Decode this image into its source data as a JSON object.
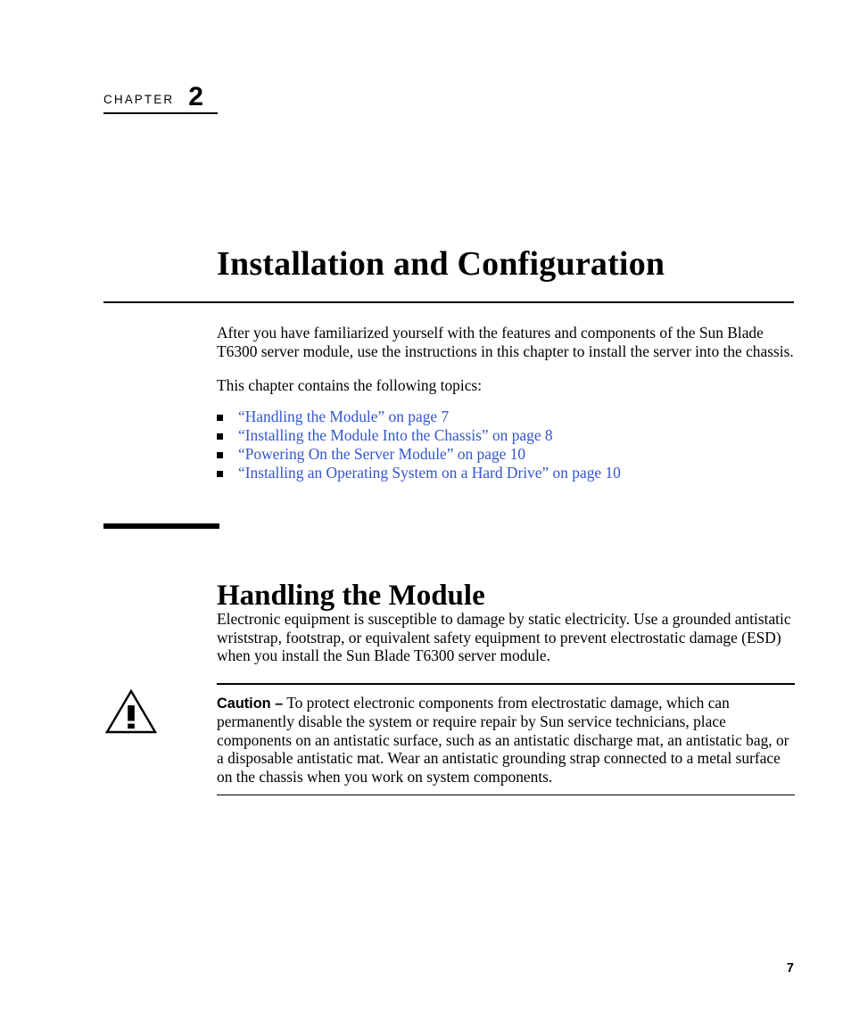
{
  "chapter": {
    "label": "CHAPTER",
    "number": "2",
    "title": "Installation and Configuration"
  },
  "intro": {
    "paragraph": "After you have familiarized yourself with the features and components of the Sun Blade T6300 server module, use the instructions in this chapter to install the server into the chassis.",
    "topics_lead": "This chapter contains the following topics:",
    "topics": [
      "“Handling the Module” on page 7",
      "“Installing the Module Into the Chassis” on page 8",
      "“Powering On the Server Module” on page 10",
      "“Installing an Operating System on a Hard Drive” on page 10"
    ]
  },
  "section": {
    "heading": "Handling the Module",
    "paragraph": "Electronic equipment is susceptible to damage by static electricity. Use a grounded antistatic wriststrap, footstrap, or equivalent safety equipment to prevent electrostatic damage (ESD) when you install the Sun Blade T6300 server module."
  },
  "caution": {
    "label": "Caution –",
    "text": " To protect electronic components from electrostatic damage, which can permanently disable the system or require repair by Sun service technicians, place components on an antistatic surface, such as an antistatic discharge mat, an antistatic bag, or a disposable antistatic mat. Wear an antistatic grounding strap connected to a metal surface on the chassis when you work on system components."
  },
  "footer": {
    "page_number": "7"
  },
  "colors": {
    "link": "#3355cc",
    "text": "#000000",
    "background": "#ffffff"
  }
}
